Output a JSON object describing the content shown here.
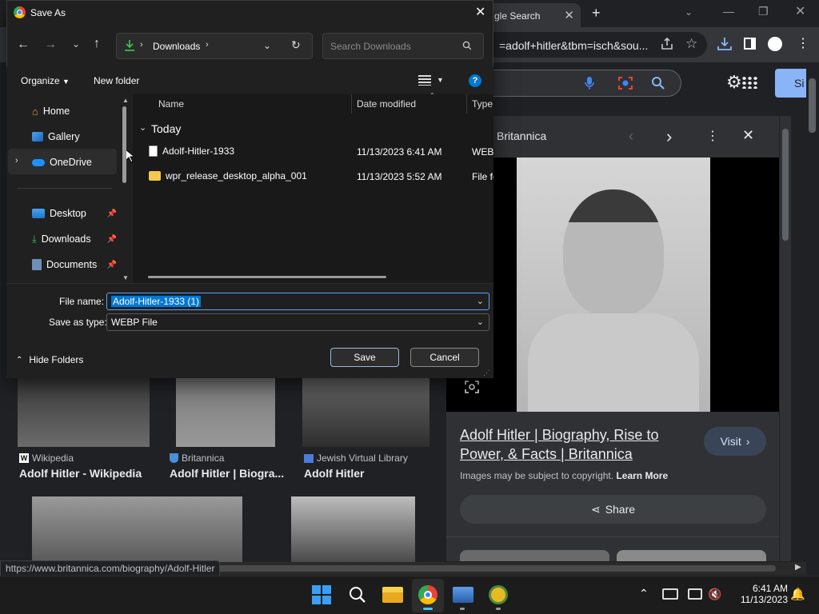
{
  "browser": {
    "tab_title": "gle Search",
    "url": "=adolf+hitler&tbm=isch&sou...",
    "signin_label": "Si",
    "status_url": "https://www.britannica.com/biography/Adolf-Hitler"
  },
  "images_panel": {
    "source": "Britannica",
    "headline": "Adolf Hitler | Biography, Rise to Power, & Facts | Britannica",
    "visit_label": "Visit",
    "copyright": "Images may be subject to copyright.",
    "learn_more": "Learn More",
    "share_label": "Share"
  },
  "results": [
    {
      "source": "Wikipedia",
      "title": "Adolf Hitler - Wikipedia"
    },
    {
      "source": "Britannica",
      "title": "Adolf Hitler | Biogra..."
    },
    {
      "source": "Jewish Virtual Library",
      "title": "Adolf Hitler"
    }
  ],
  "dialog": {
    "title": "Save As",
    "address": "Downloads",
    "search_placeholder": "Search Downloads",
    "organize_label": "Organize",
    "new_folder_label": "New folder",
    "nav_items": [
      "Home",
      "Gallery",
      "OneDrive",
      "Desktop",
      "Downloads",
      "Documents"
    ],
    "columns": {
      "name": "Name",
      "date": "Date modified",
      "type": "Type"
    },
    "group_label": "Today",
    "files": [
      {
        "name": "Adolf-Hitler-1933",
        "date": "11/13/2023 6:41 AM",
        "type": "WEBP"
      },
      {
        "name": "wpr_release_desktop_alpha_001",
        "date": "11/13/2023 5:52 AM",
        "type": "File fo"
      }
    ],
    "file_name_label": "File name:",
    "file_name_value": "Adolf-Hitler-1933 (1)",
    "save_type_label": "Save as type:",
    "save_type_value": "WEBP File",
    "hide_folders_label": "Hide Folders",
    "save_label": "Save",
    "cancel_label": "Cancel"
  },
  "taskbar": {
    "time": "6:41 AM",
    "date": "11/13/2023"
  },
  "colors": {
    "accent": "#8ab4f8",
    "selection": "#0078d4",
    "download_green": "#3fb950"
  }
}
